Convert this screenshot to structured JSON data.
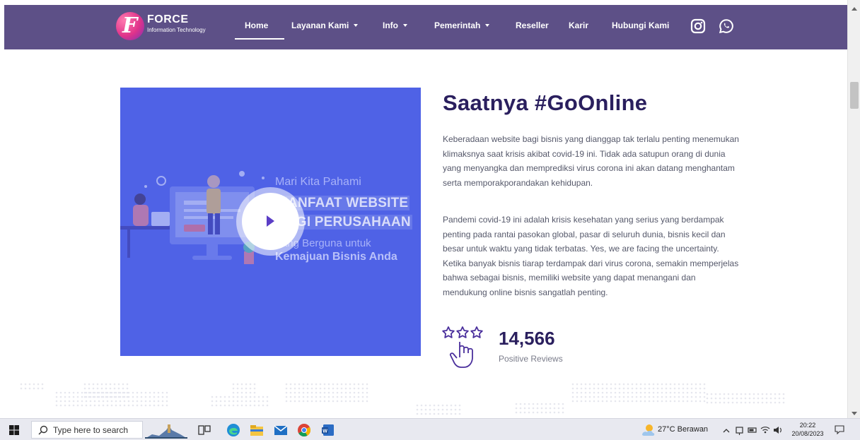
{
  "navbar": {
    "logo": {
      "name": "FORCE",
      "sub": "Information Technology"
    },
    "items": [
      {
        "label": "Home",
        "dropdown": false
      },
      {
        "label": "Layanan Kami",
        "dropdown": true
      },
      {
        "label": "Info",
        "dropdown": true
      },
      {
        "label": "Pemerintah",
        "dropdown": true
      },
      {
        "label": "Reseller",
        "dropdown": false
      },
      {
        "label": "Karir",
        "dropdown": false
      },
      {
        "label": "Hubungi Kami",
        "dropdown": false
      }
    ],
    "active": "Home",
    "social_icons": [
      "instagram-icon",
      "whatsapp-icon"
    ],
    "background": "#5d5087"
  },
  "video": {
    "line1": "Mari Kita Pahami",
    "line2a": "MANFAAT WEBSITE",
    "line2b": "BAGI PERUSAHAAN",
    "line3": "Yang Berguna untuk",
    "line4": "Kemajuan Bisnis Anda",
    "background": "#4f62e6"
  },
  "content": {
    "heading": "Saatnya #GoOnline",
    "paragraph1": "Keberadaan website bagi bisnis yang dianggap tak terlalu penting menemukan klimaksnya saat krisis akibat covid-19 ini. Tidak ada satupun orang di dunia yang menyangka dan memprediksi virus corona ini akan datang menghantam serta memporakporandakan kehidupan.",
    "paragraph2": "Pandemi covid-19 ini adalah krisis kesehatan yang serius yang berdampak penting pada rantai pasokan global, pasar di seluruh dunia, bisnis kecil dan besar untuk waktu yang tidak terbatas. Yes, we are facing the uncertainty. Ketika banyak bisnis tiarap terdampak dari virus corona, semakin memperjelas bahwa sebagai bisnis, memiliki website yang dapat menangani dan mendukung online bisnis sangatlah penting.",
    "reviews_count": "14,566",
    "reviews_label": "Positive Reviews",
    "heading_color": "#2a1f5e"
  },
  "taskbar": {
    "search_placeholder": "Type here to search",
    "weather": "27°C  Berawan",
    "time": "20:22",
    "date": "20/08/2023",
    "pinned": [
      "task-view-icon",
      "edge-icon",
      "file-explorer-icon",
      "mail-icon",
      "chrome-icon",
      "word-icon"
    ]
  }
}
